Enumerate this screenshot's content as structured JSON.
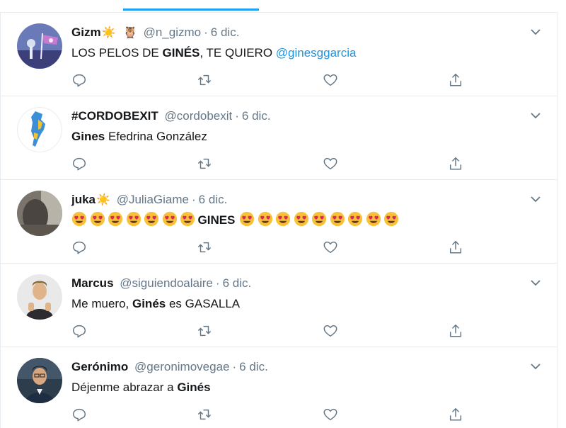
{
  "colors": {
    "accent": "#1da1f2",
    "mention": "#1b95e0",
    "secondary_text": "#657786",
    "divider": "#e6ecf0"
  },
  "tweets": [
    {
      "name": "Gizm",
      "name_emojis": [
        "☀️",
        "🦉"
      ],
      "handle": "@n_gizmo",
      "separator": "·",
      "date": "6 dic.",
      "text_parts": [
        "LOS PELOS DE ",
        "GINÉS",
        ", TE QUIERO ",
        "@ginesggarcia"
      ]
    },
    {
      "name": "#CORDOBEXIT",
      "handle": "@cordobexit",
      "separator": "·",
      "date": "6 dic.",
      "text_parts": [
        "Gines",
        " Efedrina González"
      ]
    },
    {
      "name": "juka",
      "name_emojis": [
        "☀️"
      ],
      "handle": "@JuliaGiame",
      "separator": "·",
      "date": "6 dic.",
      "emoji_name": "smiling-face-with-heart-eyes",
      "emoji_count_before": 7,
      "emoji_count_after": 9,
      "text_parts": [
        "GINES"
      ]
    },
    {
      "name": "Marcus",
      "handle": "@siguiendoalaire",
      "separator": "·",
      "date": "6 dic.",
      "text_parts": [
        "Me muero, ",
        "Ginés",
        " es GASALLA"
      ]
    },
    {
      "name": "Gerónimo",
      "handle": "@geronimovegae",
      "separator": "·",
      "date": "6 dic.",
      "text_parts": [
        "Déjenme abrazar a ",
        "Ginés"
      ]
    }
  ],
  "icons": {
    "reply": "reply-icon",
    "retweet": "retweet-icon",
    "like": "like-icon",
    "share": "share-icon",
    "more": "chevron-down-icon"
  }
}
